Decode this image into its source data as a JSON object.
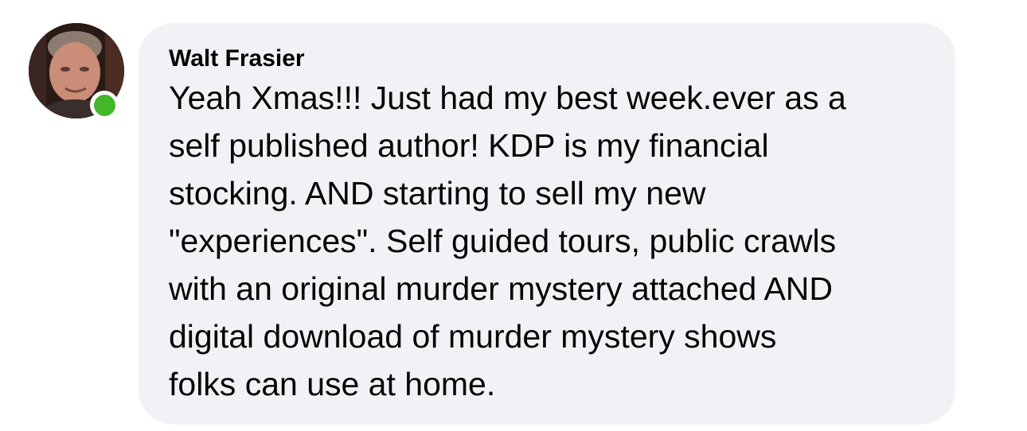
{
  "comment": {
    "author_name": "Walt Frasier",
    "text": "Yeah Xmas!!! Just had my best week.ever as a\nself published author! KDP is my financial\nstocking. AND starting to sell my new\n\"experiences\". Self guided tours, public crawls\nwith an original murder mystery attached AND\ndigital download of murder mystery shows\nfolks can use at home.",
    "online_status": "active",
    "colors": {
      "bubble_background": "#f0f2f5",
      "text": "#050505",
      "online_indicator": "#42b72a"
    }
  }
}
